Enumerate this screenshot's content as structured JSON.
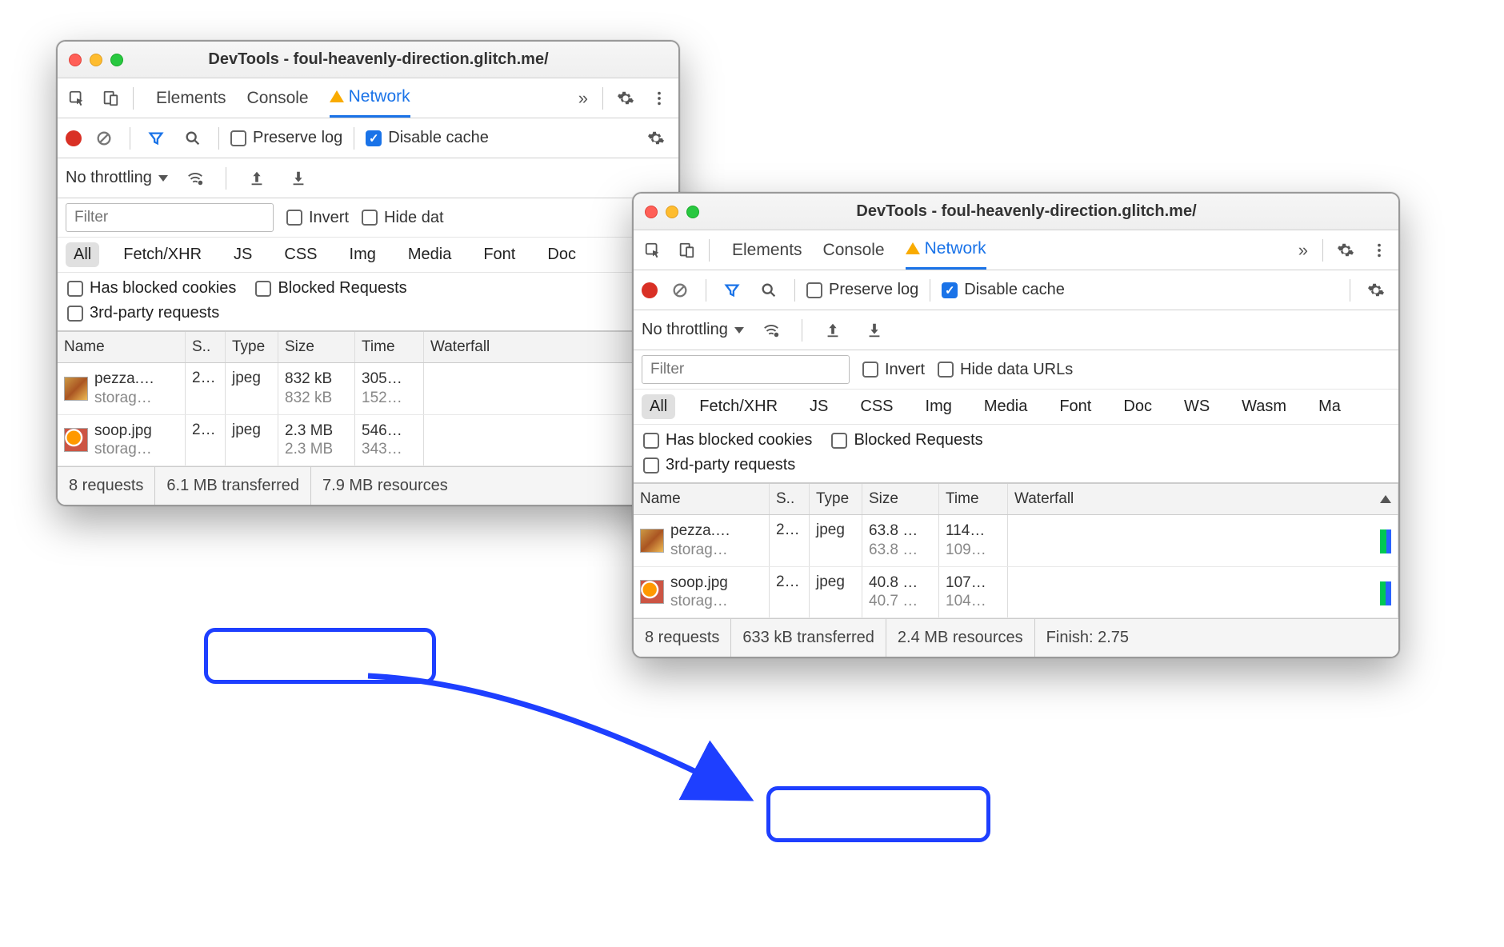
{
  "window1": {
    "title": "DevTools - foul-heavenly-direction.glitch.me/",
    "tabs": {
      "elements": "Elements",
      "console": "Console",
      "network": "Network"
    },
    "toolbar": {
      "preserve_log": "Preserve log",
      "disable_cache": "Disable cache"
    },
    "throttling": "No throttling",
    "filter_placeholder": "Filter",
    "invert": "Invert",
    "hide_data": "Hide dat",
    "chips": [
      "All",
      "Fetch/XHR",
      "JS",
      "CSS",
      "Img",
      "Media",
      "Font",
      "Doc"
    ],
    "checks": {
      "blocked_cookies": "Has blocked cookies",
      "blocked_requests": "Blocked Requests",
      "third_party": "3rd-party requests"
    },
    "columns": {
      "name": "Name",
      "status": "S..",
      "type": "Type",
      "size": "Size",
      "time": "Time",
      "waterfall": "Waterfall"
    },
    "rows": [
      {
        "name": "pezza.…",
        "domain": "storag…",
        "status": "2…",
        "type": "jpeg",
        "size1": "832 kB",
        "size2": "832 kB",
        "time1": "305…",
        "time2": "152…",
        "thumb": "pz"
      },
      {
        "name": "soop.jpg",
        "domain": "storag…",
        "status": "2…",
        "type": "jpeg",
        "size1": "2.3 MB",
        "size2": "2.3 MB",
        "time1": "546…",
        "time2": "343…",
        "thumb": "sp"
      }
    ],
    "status": {
      "requests": "8 requests",
      "transferred": "6.1 MB transferred",
      "resources": "7.9 MB resources"
    }
  },
  "window2": {
    "title": "DevTools - foul-heavenly-direction.glitch.me/",
    "tabs": {
      "elements": "Elements",
      "console": "Console",
      "network": "Network"
    },
    "toolbar": {
      "preserve_log": "Preserve log",
      "disable_cache": "Disable cache"
    },
    "throttling": "No throttling",
    "filter_placeholder": "Filter",
    "invert": "Invert",
    "hide_data": "Hide data URLs",
    "chips": [
      "All",
      "Fetch/XHR",
      "JS",
      "CSS",
      "Img",
      "Media",
      "Font",
      "Doc",
      "WS",
      "Wasm",
      "Ma"
    ],
    "checks": {
      "blocked_cookies": "Has blocked cookies",
      "blocked_requests": "Blocked Requests",
      "third_party": "3rd-party requests"
    },
    "columns": {
      "name": "Name",
      "status": "S..",
      "type": "Type",
      "size": "Size",
      "time": "Time",
      "waterfall": "Waterfall"
    },
    "rows": [
      {
        "name": "pezza.…",
        "domain": "storag…",
        "status": "2…",
        "type": "jpeg",
        "size1": "63.8 …",
        "size2": "63.8 …",
        "time1": "114…",
        "time2": "109…",
        "thumb": "pz"
      },
      {
        "name": "soop.jpg",
        "domain": "storag…",
        "status": "2…",
        "type": "jpeg",
        "size1": "40.8 …",
        "size2": "40.7 …",
        "time1": "107…",
        "time2": "104…",
        "thumb": "sp"
      }
    ],
    "status": {
      "requests": "8 requests",
      "transferred": "633 kB transferred",
      "resources": "2.4 MB resources",
      "finish": "Finish: 2.75"
    }
  }
}
